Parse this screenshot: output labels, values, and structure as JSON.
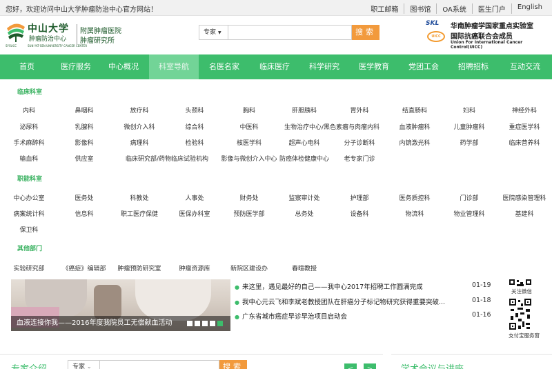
{
  "topbar": {
    "welcome": "您好，欢迎访问中山大学肿瘤防治中心官方网站！",
    "links": [
      "职工邮箱",
      "图书馆",
      "OA系统",
      "医生门户",
      "English"
    ]
  },
  "logo": {
    "cn_name": "中山大学",
    "cn_sub": "肿瘤防治中心",
    "abbr": "SYSUCC",
    "en": "SUN YAT-SEN UNIVERSITY CANCER CENTER",
    "since": "SINCE 1964",
    "affiliate1": "附属肿瘤医院",
    "affiliate2": "肿瘤研究所"
  },
  "search": {
    "select": "专家",
    "placeholder": "",
    "button": "搜索"
  },
  "labs": {
    "icon1": "SKL",
    "icon2": "UICC",
    "line1": "华南肿瘤学国家重点实验室",
    "line2": "国际抗癌联合会成员",
    "line3": "Union For International Cancer Control(UICC)"
  },
  "nav": [
    "首页",
    "医疗服务",
    "中心概况",
    "科室导航",
    "名医名家",
    "临床医疗",
    "科学研究",
    "医学教育",
    "党团工会",
    "招聘招标",
    "互动交流"
  ],
  "mega": {
    "clinical_title": "临床科室",
    "clinical": [
      [
        "内科",
        "鼻咽科",
        "放疗科",
        "头颈科",
        "胸科",
        "肝胆胰科",
        "胃外科",
        "结直肠科",
        "妇科",
        "神经外科"
      ],
      [
        "泌尿科",
        "乳腺科",
        "微创介入科",
        "综合科",
        "中医科",
        "生物治疗中心/黑色素瘤与肉瘤内科",
        "血液肿瘤科",
        "儿童肿瘤科",
        "重症医学科"
      ],
      [
        "手术麻醉科",
        "影像科",
        "病理科",
        "检验科",
        "核医学科",
        "超声心电科",
        "分子诊断科",
        "内镜激光科",
        "药学部",
        "临床营养科"
      ],
      [
        "输血科",
        "供应室",
        "临床研究部/药物临床试验机构",
        "影像与微创介入中心",
        "防癌体检健康中心",
        "老专家门诊"
      ]
    ],
    "functional_title": "职能科室",
    "functional": [
      [
        "中心办公室",
        "医务处",
        "科教处",
        "人事处",
        "财务处",
        "监察审计处",
        "护理部",
        "医务质控科",
        "门诊部",
        "医院感染管理科"
      ],
      [
        "病案统计科",
        "信息科",
        "职工医疗保健",
        "医保办科室",
        "预防医学部",
        "总务处",
        "设备科",
        "物流科",
        "物业管理科",
        "基建科"
      ],
      [
        "保卫科"
      ]
    ],
    "other_title": "其他部门",
    "other": [
      [
        "实验研究部",
        "《癌症》编辑部",
        "肿瘤预防研究室",
        "肿瘤资源库",
        "新院区建设办",
        "春暄教授"
      ]
    ]
  },
  "slider": {
    "caption": "血液连接你我——2016年度我院员工无偿献血活动",
    "slides": 5,
    "active_index": 4
  },
  "news": [
    {
      "title": "来这里，遇见最好的自己——我中心2017年招聘工作圆满完成",
      "date": "01-19"
    },
    {
      "title": "我中心元云飞和李斌老教授团队在肝癌分子标记物研究获得重要突破...",
      "date": "01-18"
    },
    {
      "title": "广东省城市癌症早诊早治项目启动会",
      "date": "01-16"
    }
  ],
  "qr": {
    "label1": "关注微信",
    "label2": "支付宝服务窗"
  },
  "expert": {
    "title": "专家介绍",
    "select": "专家",
    "button": "搜索",
    "prev": "<",
    "next": ">"
  },
  "conference": {
    "title": "学术会议与讲座"
  }
}
